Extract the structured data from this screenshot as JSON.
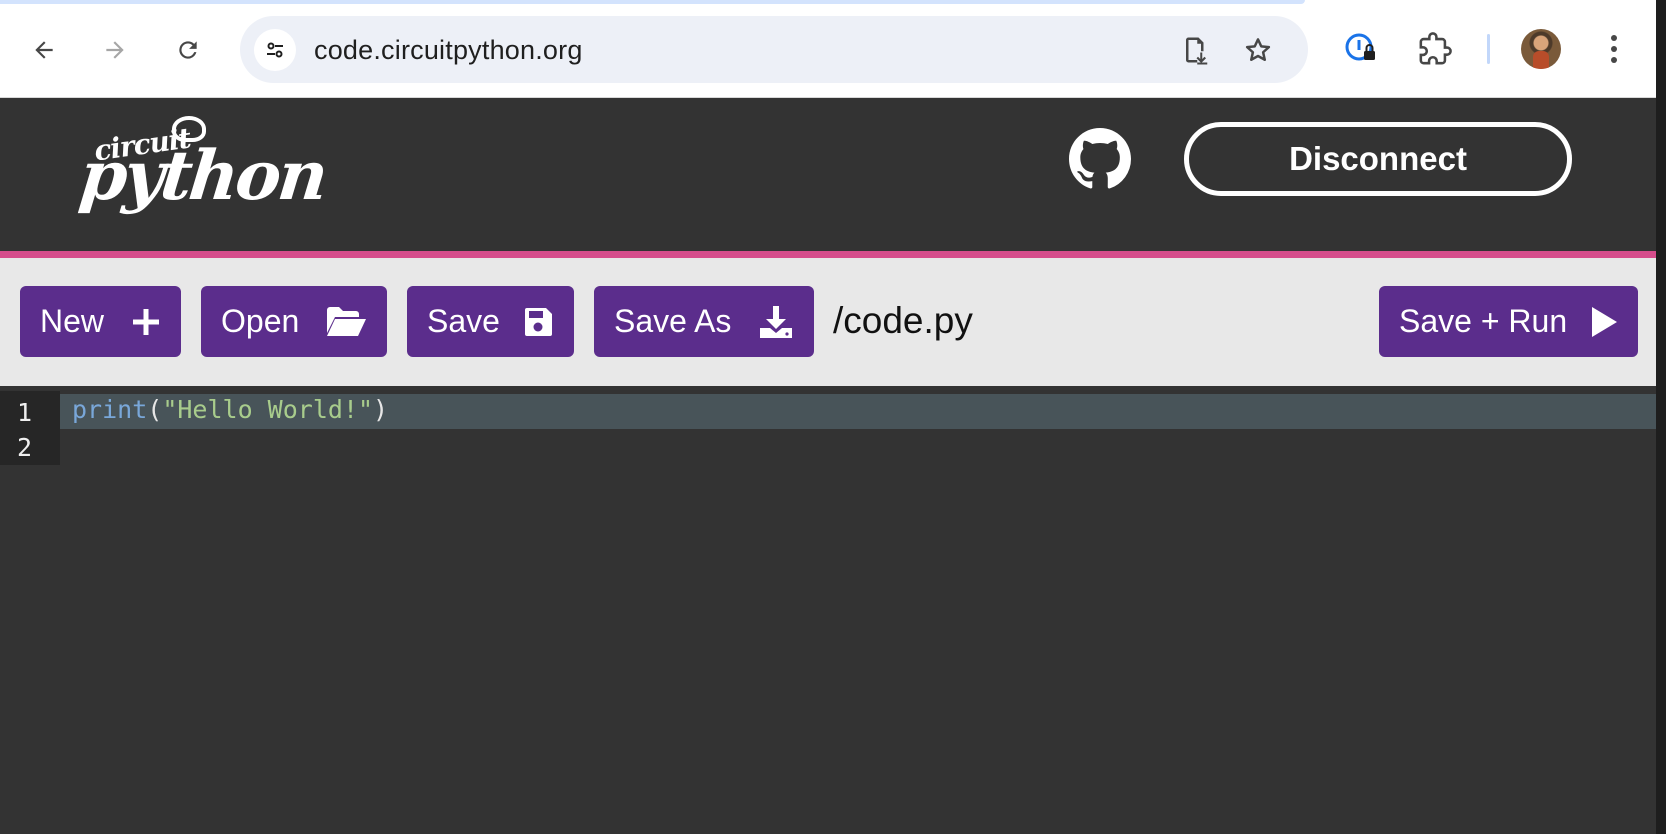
{
  "browser": {
    "url": "code.circuitpython.org",
    "icons": [
      "back-arrow-icon",
      "forward-arrow-icon",
      "reload-icon",
      "site-info-icon",
      "install-page-icon",
      "bookmark-star-icon",
      "password-manager-icon",
      "extensions-icon",
      "avatar",
      "more-menu-icon"
    ]
  },
  "header": {
    "logo_top": "circuit",
    "logo_bottom": "python",
    "github_icon": "github-icon",
    "disconnect_label": "Disconnect",
    "accent_color": "#d64d8c"
  },
  "toolbar": {
    "new_label": "New",
    "open_label": "Open",
    "save_label": "Save",
    "save_as_label": "Save As",
    "save_run_label": "Save + Run",
    "file_path": "/code.py",
    "button_color": "#5b2d8c"
  },
  "editor": {
    "line_numbers": [
      "1",
      "2"
    ],
    "line1": {
      "fn": "print",
      "open": "(",
      "str": "\"Hello World!\"",
      "close": ")"
    }
  }
}
